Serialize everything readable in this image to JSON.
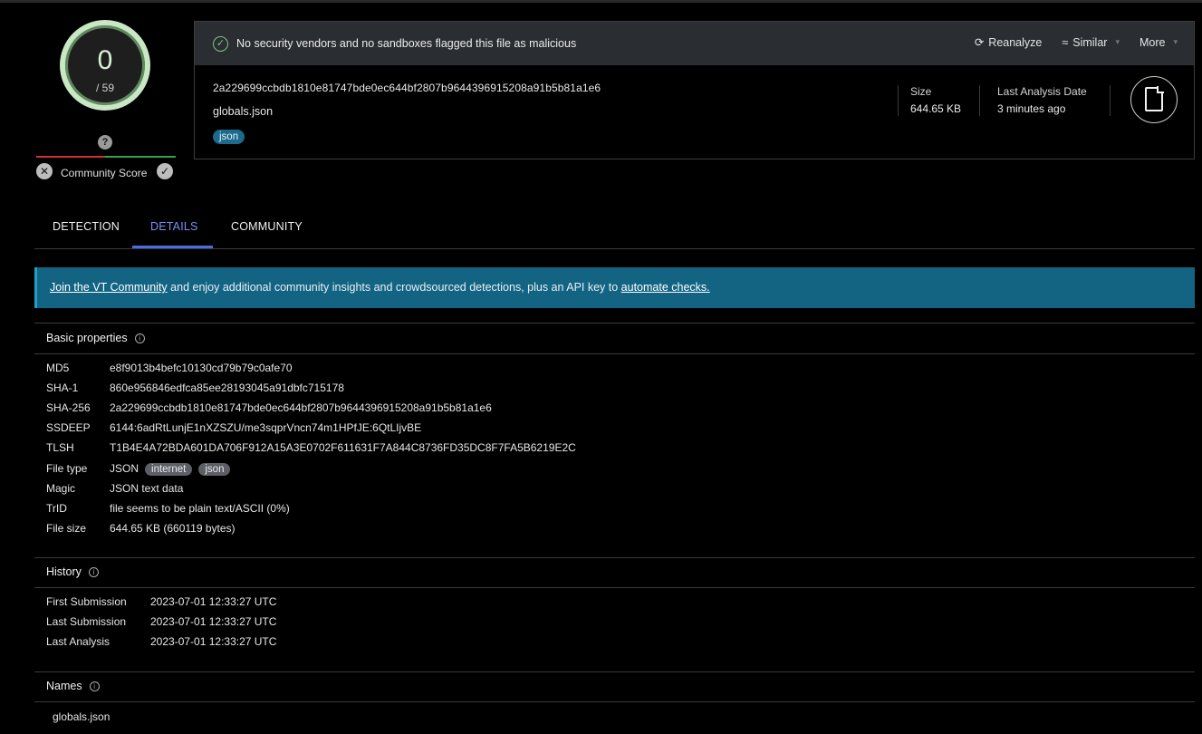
{
  "score": {
    "detections": "0",
    "total": "/ 59",
    "community_label": "Community Score",
    "unknown_glyph": "?"
  },
  "header": {
    "status_text": "No security vendors and no sandboxes flagged this file as malicious",
    "actions": {
      "reanalyze": "Reanalyze",
      "similar": "Similar",
      "more": "More"
    }
  },
  "file": {
    "sha256": "2a229699ccbdb1810e81747bde0ec644bf2807b9644396915208a91b5b81a1e6",
    "name": "globals.json",
    "tag": "json",
    "size_label": "Size",
    "size_value": "644.65 KB",
    "date_label": "Last Analysis Date",
    "date_value": "3 minutes ago"
  },
  "tabs": {
    "detection": "DETECTION",
    "details": "DETAILS",
    "community": "COMMUNITY",
    "active": "DETAILS"
  },
  "banner": {
    "link1": "Join the VT Community",
    "middle": " and enjoy additional community insights and crowdsourced detections, plus an API key to ",
    "link2": "automate checks."
  },
  "basic_properties": {
    "title": "Basic properties",
    "rows": [
      {
        "key": "MD5",
        "value": "e8f9013b4befc10130cd79b79c0afe70"
      },
      {
        "key": "SHA-1",
        "value": "860e956846edfca85ee28193045a91dbfc715178"
      },
      {
        "key": "SHA-256",
        "value": "2a229699ccbdb1810e81747bde0ec644bf2807b9644396915208a91b5b81a1e6"
      },
      {
        "key": "SSDEEP",
        "value": "6144:6adRtLunjE1nXZSZU/me3sqprVncn74m1HPfJE:6QtLIjvBE"
      },
      {
        "key": "TLSH",
        "value": "T1B4E4A72BDA601DA706F912A15A3E0702F611631F7A844C8736FD35DC8F7FA5B6219E2C"
      },
      {
        "key": "File type",
        "value": "JSON",
        "pills": [
          "internet",
          "json"
        ]
      },
      {
        "key": "Magic",
        "value": "JSON text data"
      },
      {
        "key": "TrID",
        "value": "file seems to be plain text/ASCII (0%)"
      },
      {
        "key": "File size",
        "value": "644.65 KB (660119 bytes)"
      }
    ]
  },
  "history": {
    "title": "History",
    "rows": [
      {
        "key": "First Submission",
        "value": "2023-07-01 12:33:27 UTC"
      },
      {
        "key": "Last Submission",
        "value": "2023-07-01 12:33:27 UTC"
      },
      {
        "key": "Last Analysis",
        "value": "2023-07-01 12:33:27 UTC"
      }
    ]
  },
  "names": {
    "title": "Names",
    "values": [
      "globals.json"
    ]
  }
}
